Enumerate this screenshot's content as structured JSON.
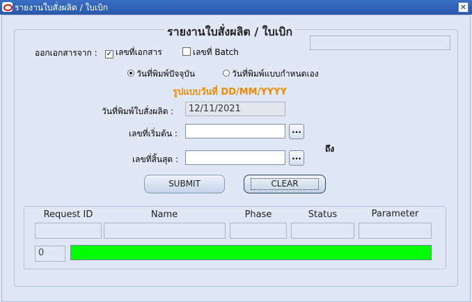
{
  "window": {
    "title": "รายงานใบสั่งผลิต / ใบเบิก",
    "close_glyph": "✕"
  },
  "form": {
    "heading": "รายงานใบสั่งผลิต / ใบเบิก",
    "top_right_value": "",
    "source_label": "ออกเอกสารจาก :",
    "checkbox_doc": {
      "label": "เลขที่เอกสาร",
      "checked": true,
      "glyph": "✓"
    },
    "checkbox_batch": {
      "label": "เลขที่ Batch",
      "checked": false
    },
    "radio_current": {
      "label": "วันที่พิมพ์ปัจจุบัน",
      "selected": true
    },
    "radio_custom": {
      "label": "วันที่พิมพ์แบบกำหนดเอง",
      "selected": false
    },
    "date_format_hint": "รูปแบบวันที่ DD/MM/YYYY",
    "print_date_label": "วันที่พิมพ์ใบสั่งผลิต :",
    "print_date_value": "12/11/2021",
    "start_no_label": "เลขที่เริ่มต้น :",
    "start_no_value": "",
    "end_no_label": "เลขที่สิ้นสุด :",
    "end_no_value": "",
    "to_label": "ถึง",
    "lov_glyph": "...",
    "submit_label": "SUBMIT",
    "clear_label": "CLEAR"
  },
  "request": {
    "columns": [
      "Request ID",
      "Name",
      "Phase",
      "Status",
      "Parameter"
    ],
    "values": {
      "request_id": "",
      "name": "",
      "phase": "",
      "status": "",
      "parameter": ""
    },
    "progress_count": "0",
    "progress_percent": 100,
    "progress_color": "#00ff00"
  }
}
